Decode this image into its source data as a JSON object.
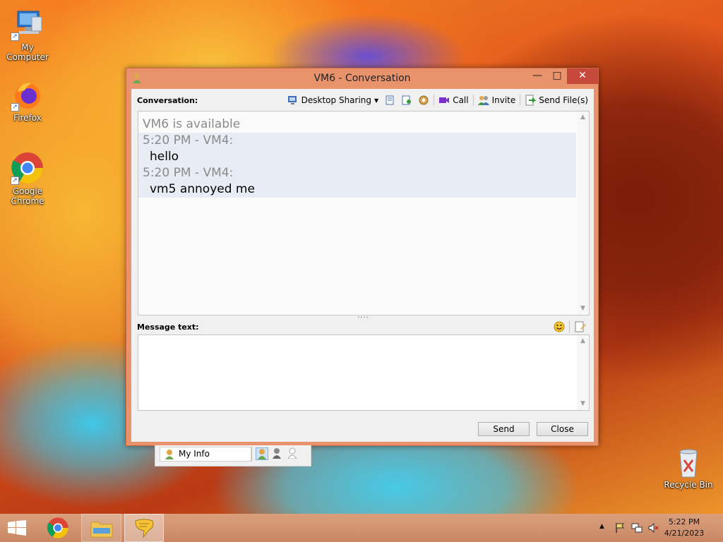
{
  "desktop": {
    "icons": [
      {
        "label": "My Computer"
      },
      {
        "label": "Firefox"
      },
      {
        "label": "Google Chrome"
      },
      {
        "label": "Recycle Bin"
      }
    ]
  },
  "window": {
    "title": "VM6 - Conversation",
    "controls": {
      "minimize": "—",
      "maximize": "□",
      "close": "✕"
    },
    "conversation_label": "Conversation:",
    "toolbar": {
      "desktop_sharing": "Desktop Sharing",
      "call": "Call",
      "invite": "Invite",
      "send_files": "Send File(s)"
    },
    "conversation": {
      "status": "VM6 is available",
      "messages": [
        {
          "header": "5:20 PM - VM4:",
          "text": "hello"
        },
        {
          "header": "5:20 PM - VM4:",
          "text": "vm5 annoyed me"
        }
      ]
    },
    "message_label": "Message text:",
    "message_value": "",
    "send_label": "Send",
    "close_label": "Close"
  },
  "buddy_bar": {
    "my_info": "My Info"
  },
  "taskbar": {
    "time": "5:22 PM",
    "date": "4/21/2023"
  },
  "colors": {
    "window_frame": "#e8936c",
    "close_button": "#c7493c",
    "message_highlight": "#e8edf5"
  }
}
